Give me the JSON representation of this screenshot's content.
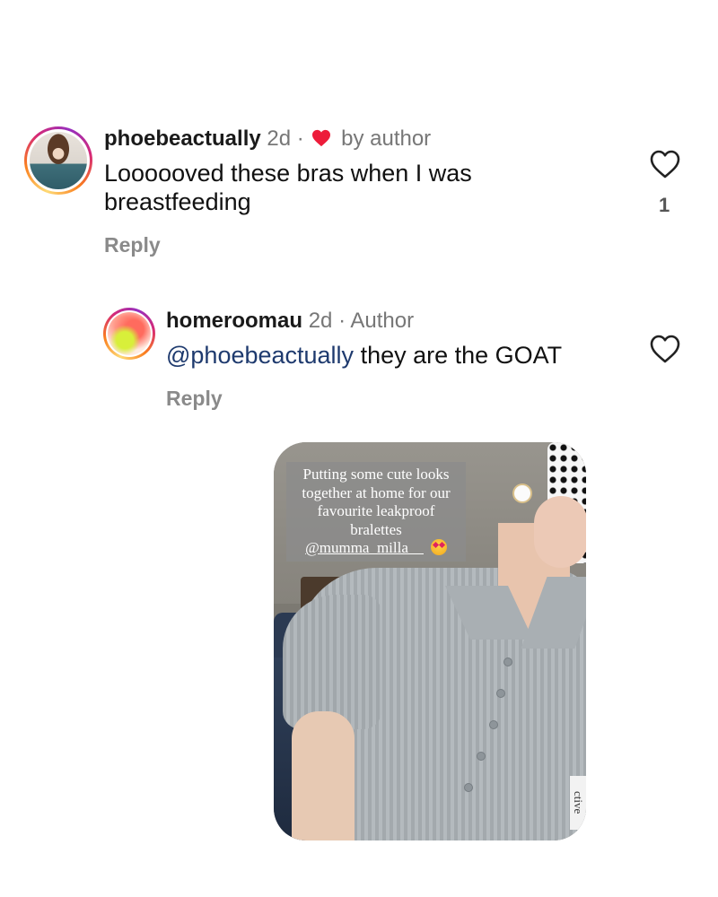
{
  "comments": [
    {
      "username": "phoebeactually",
      "time": "2d",
      "separator": "·",
      "liked_by_author_label": "by author",
      "text": "Loooooved these bras when I was breastfeeding",
      "reply_label": "Reply",
      "like_count": "1"
    },
    {
      "username": "homeroomau",
      "time": "2d",
      "separator": "·",
      "author_badge": "Author",
      "mention": "@phoebeactually",
      "text": " they are the GOAT",
      "reply_label": "Reply"
    }
  ],
  "attachment": {
    "caption": "Putting some cute looks together at home for our favourite leakproof bralettes",
    "caption_tag": "@mumma_milla__",
    "watermark": "ctive"
  },
  "colors": {
    "heart_red": "#ed1c3a",
    "muted_text": "#777777",
    "mention_blue": "#1e3a6e"
  }
}
